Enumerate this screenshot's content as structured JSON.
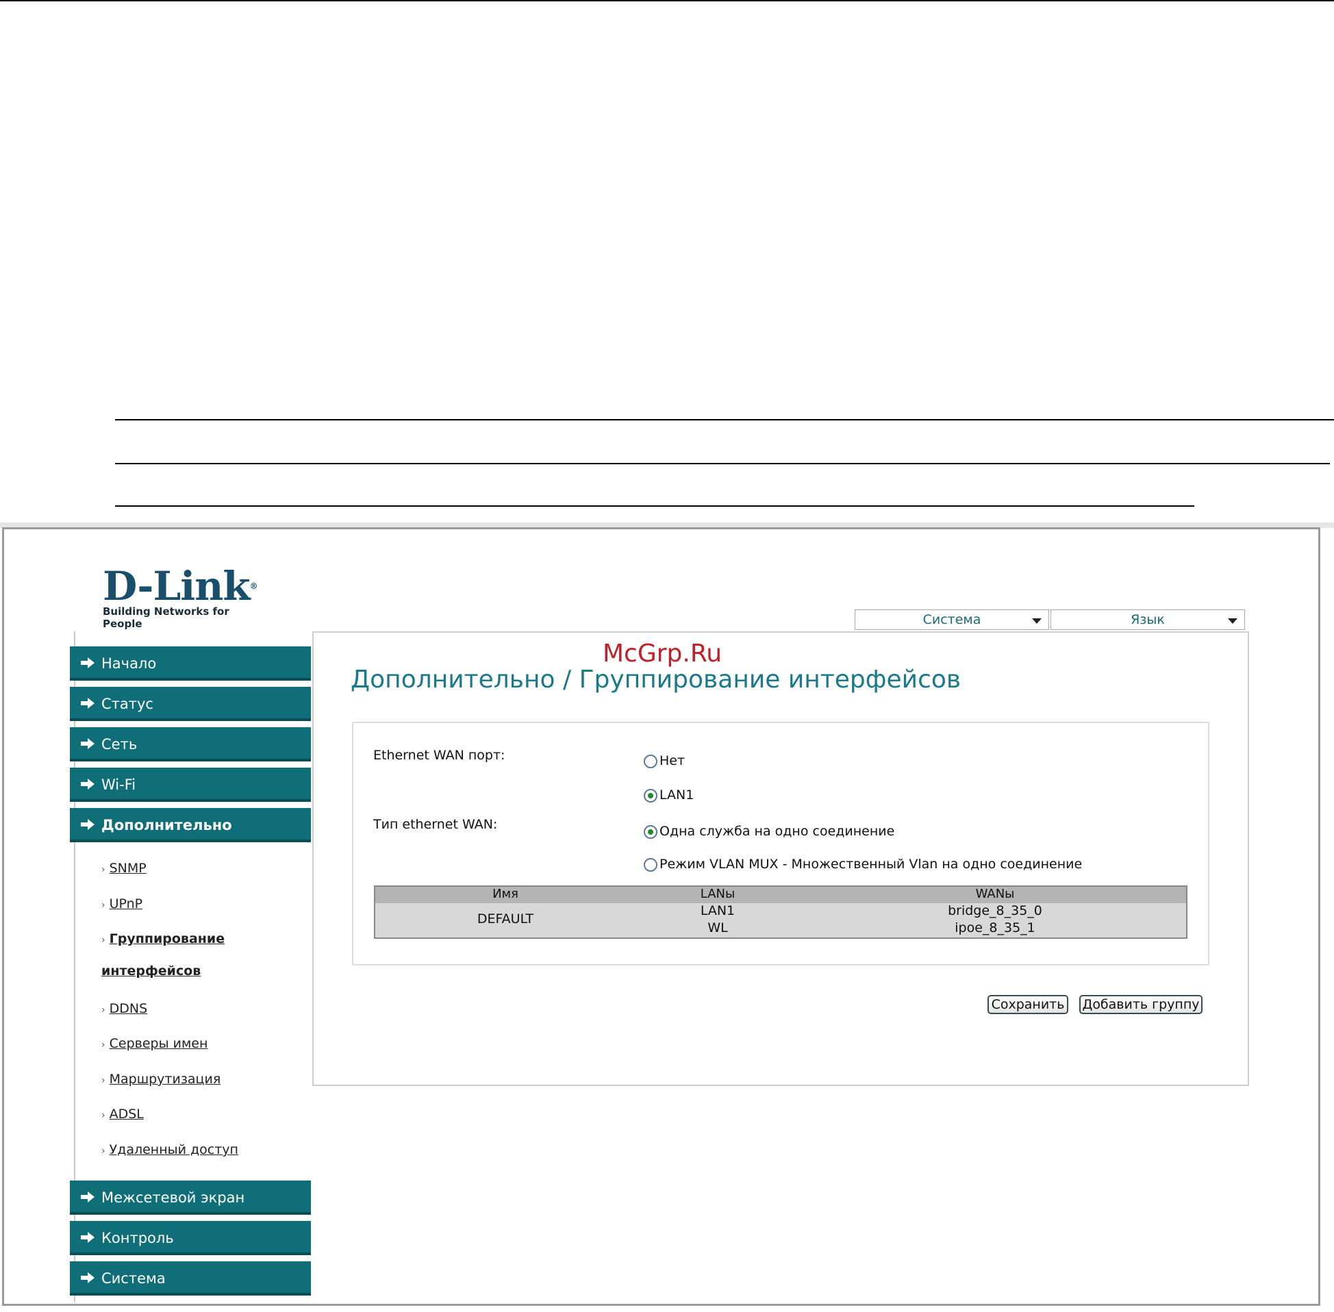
{
  "logo": {
    "main": "D-Link",
    "reg": "®",
    "tagline": "Building Networks for People"
  },
  "watermark": "McGrp.Ru",
  "header_menus": [
    {
      "label": "Система"
    },
    {
      "label": "Язык"
    }
  ],
  "sidebar": {
    "items": [
      {
        "label": "Начало"
      },
      {
        "label": "Статус"
      },
      {
        "label": "Сеть"
      },
      {
        "label": "Wi-Fi"
      },
      {
        "label": "Дополнительно"
      },
      {
        "label": "Межсетевой экран"
      },
      {
        "label": "Контроль"
      },
      {
        "label": "Система"
      }
    ],
    "submenu": [
      {
        "label": "SNMP"
      },
      {
        "label": "UPnP"
      },
      {
        "label": "Группирование"
      },
      {
        "label": "интерфейсов"
      },
      {
        "label": "DDNS"
      },
      {
        "label": "Серверы имен"
      },
      {
        "label": "Маршрутизация"
      },
      {
        "label": "ADSL"
      },
      {
        "label": "Удаленный доступ"
      }
    ]
  },
  "main": {
    "title": "Дополнительно / Группирование интерфейсов",
    "wan_port": {
      "label": "Ethernet WAN порт:",
      "options": [
        {
          "label": "Нет",
          "checked": false
        },
        {
          "label": "LAN1",
          "checked": true
        }
      ]
    },
    "wan_type": {
      "label": "Тип ethernet WAN:",
      "options": [
        {
          "label": "Одна служба на одно соединение",
          "checked": true
        },
        {
          "label": "Режим VLAN MUX - Множественный Vlan на одно соединение",
          "checked": false
        }
      ]
    },
    "table": {
      "headers": [
        "Имя",
        "LANы",
        "WANы"
      ],
      "rows": [
        {
          "name": "DEFAULT",
          "lans": [
            "LAN1",
            "WL"
          ],
          "wans": [
            "bridge_8_35_0",
            "ipoe_8_35_1"
          ]
        }
      ]
    },
    "buttons": {
      "save": "Сохранить",
      "add_group": "Добавить группу"
    }
  }
}
